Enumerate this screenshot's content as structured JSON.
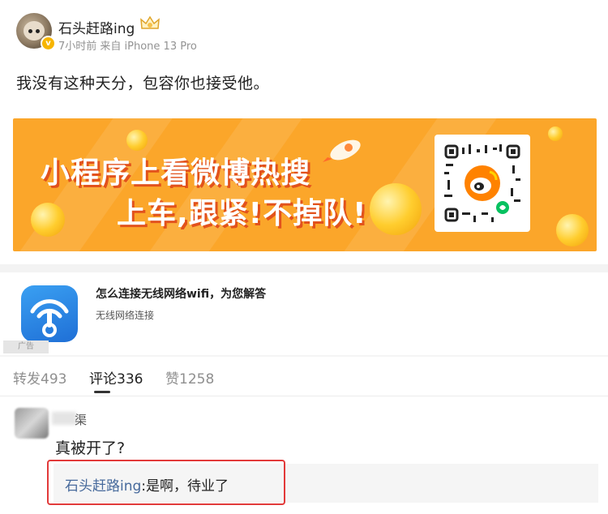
{
  "post": {
    "username": "石头赶路ing",
    "meta": "7小时前 来自 iPhone 13 Pro",
    "verified_badge": "v",
    "content": "我没有这种天分，包容你也接受他。"
  },
  "banner": {
    "line1": "小程序上看微博热搜",
    "line2": "上车,跟紧!不掉队!",
    "bg_color": "#fba62a"
  },
  "ad": {
    "title": "怎么连接无线网络wifi，为您解答",
    "subtitle": "无线网络连接",
    "badge": "广告"
  },
  "tabs": [
    {
      "label": "转发493"
    },
    {
      "label": "评论336"
    },
    {
      "label": "赞1258"
    }
  ],
  "comment": {
    "name_visible": "渠",
    "text": "真被开了?",
    "reply_user": "石头赶路ing",
    "reply_body": ":是啊，待业了"
  },
  "colors": {
    "link": "#476a9c",
    "highlight": "#e23a3a",
    "accent": "#fba62a"
  }
}
